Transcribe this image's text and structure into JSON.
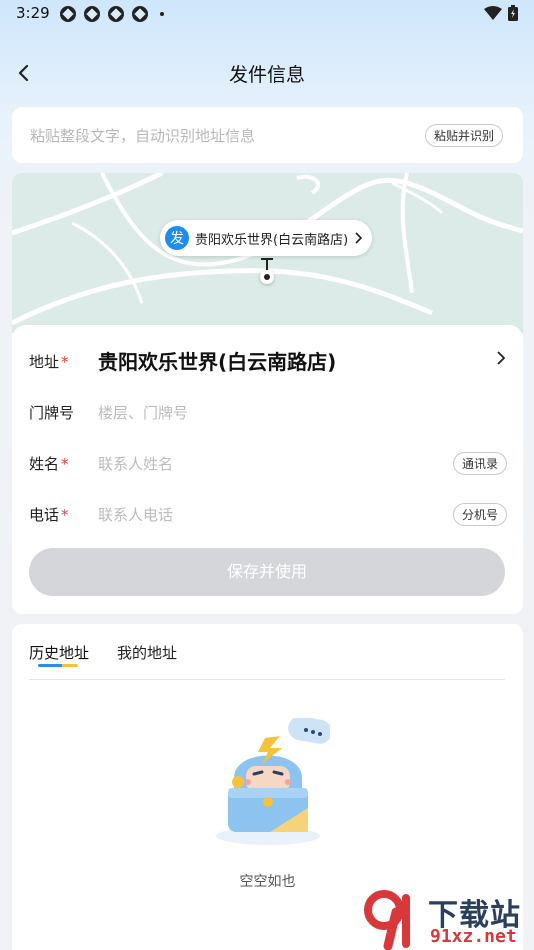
{
  "status_bar": {
    "time": "3:29",
    "notification_icons": [
      "notification-icon",
      "notification-icon",
      "notification-icon",
      "notification-icon"
    ],
    "right_icons": [
      "wifi-icon",
      "battery-icon"
    ]
  },
  "header": {
    "title": "发件信息",
    "back_icon": "chevron-left-icon"
  },
  "paste": {
    "placeholder": "粘贴整段文字，自动识别地址信息",
    "button_label": "粘贴并识别"
  },
  "map": {
    "pin_badge": "发",
    "pin_label": "贵阳欢乐世界(白云南路店)",
    "chevron_icon": "chevron-right-icon",
    "water_color": "#dcebe7",
    "road_color": "#ffffff"
  },
  "form": {
    "address": {
      "label": "地址",
      "required_mark": "*",
      "value": "贵阳欢乐世界(白云南路店)"
    },
    "house_number": {
      "label": "门牌号",
      "placeholder": "楼层、门牌号"
    },
    "name": {
      "label": "姓名",
      "required_mark": "*",
      "placeholder": "联系人姓名",
      "button_label": "通讯录"
    },
    "phone": {
      "label": "电话",
      "required_mark": "*",
      "placeholder": "联系人电话",
      "button_label": "分机号"
    },
    "save_button": "保存并使用"
  },
  "history": {
    "tabs": [
      {
        "label": "历史地址",
        "active": true
      },
      {
        "label": "我的地址",
        "active": false
      }
    ],
    "empty_text": "空空如也"
  },
  "watermark": {
    "name": "下载站",
    "url": "91xz.net"
  },
  "colors": {
    "accent_blue": "#1f8cf0",
    "accent_yellow": "#f5c33b",
    "required_red": "#e23c3c",
    "disabled_button": "#d4d6da"
  }
}
